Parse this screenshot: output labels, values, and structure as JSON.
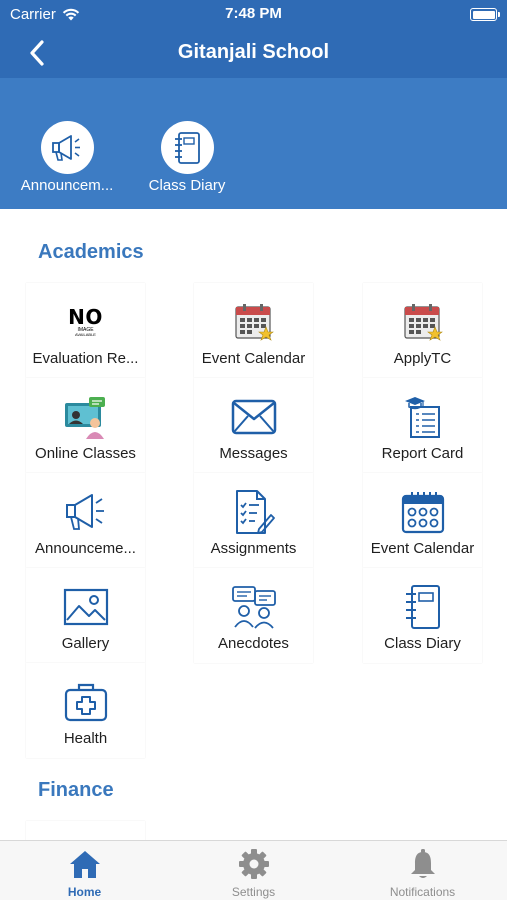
{
  "status_bar": {
    "carrier": "Carrier",
    "time": "7:48 PM"
  },
  "nav": {
    "title": "Gitanjali School"
  },
  "quick_actions": [
    {
      "label": "Announcem...",
      "icon": "megaphone-icon"
    },
    {
      "label": "Class Diary",
      "icon": "notebook-icon"
    }
  ],
  "sections": {
    "academics": {
      "title": "Academics",
      "tiles": [
        {
          "label": "Evaluation Re...",
          "icon": "no-image-icon"
        },
        {
          "label": "Event Calendar",
          "icon": "calendar-star-icon"
        },
        {
          "label": "ApplyTC",
          "icon": "calendar-star-icon"
        },
        {
          "label": "Online Classes",
          "icon": "online-class-icon"
        },
        {
          "label": "Messages",
          "icon": "envelope-icon"
        },
        {
          "label": "Report Card",
          "icon": "report-card-icon"
        },
        {
          "label": "Announceme...",
          "icon": "megaphone-icon"
        },
        {
          "label": "Assignments",
          "icon": "assignment-icon"
        },
        {
          "label": "Event Calendar",
          "icon": "calendar-grid-icon"
        },
        {
          "label": "Gallery",
          "icon": "gallery-icon"
        },
        {
          "label": "Anecdotes",
          "icon": "anecdotes-icon"
        },
        {
          "label": "Class Diary",
          "icon": "notebook-icon"
        },
        {
          "label": "Health",
          "icon": "first-aid-icon"
        }
      ]
    },
    "finance": {
      "title": "Finance"
    }
  },
  "no_image": {
    "big": "NO",
    "small1": "IMAGE",
    "small2": "AVAILABLE"
  },
  "tab_bar": [
    {
      "label": "Home",
      "icon": "home-icon",
      "active": true
    },
    {
      "label": "Settings",
      "icon": "gear-icon",
      "active": false
    },
    {
      "label": "Notifications",
      "icon": "bell-icon",
      "active": false
    }
  ],
  "colors": {
    "primary": "#2f6bb5",
    "quickbar": "#3d7cc4",
    "section_title": "#3a78bd",
    "icon_blue": "#1f5fa8"
  }
}
